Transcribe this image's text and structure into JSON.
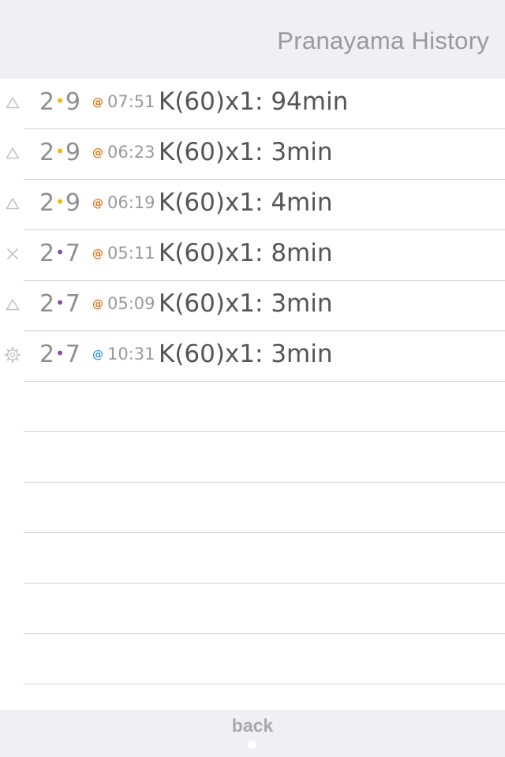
{
  "header": {
    "title": "Pranayama History"
  },
  "colors": {
    "dot_yellow": "#f4b400",
    "dot_purple": "#7a55a0",
    "at_orange": "#e0781e",
    "at_blue": "#3a9ad9",
    "icon_gray": "#c4c4c4"
  },
  "history": [
    {
      "status_icon": "triangle-icon",
      "day_left": "2",
      "day_right": "9",
      "dot_color": "yellow",
      "at_symbol": "@",
      "at_color": "orange",
      "time": "07:51",
      "entry": "K(60)x1: 94min"
    },
    {
      "status_icon": "triangle-icon",
      "day_left": "2",
      "day_right": "9",
      "dot_color": "yellow",
      "at_symbol": "@",
      "at_color": "orange",
      "time": "06:23",
      "entry": "K(60)x1: 3min"
    },
    {
      "status_icon": "triangle-icon",
      "day_left": "2",
      "day_right": "9",
      "dot_color": "yellow",
      "at_symbol": "@",
      "at_color": "orange",
      "time": "06:19",
      "entry": "K(60)x1: 4min"
    },
    {
      "status_icon": "x-icon",
      "day_left": "2",
      "day_right": "7",
      "dot_color": "purple",
      "at_symbol": "@",
      "at_color": "orange",
      "time": "05:11",
      "entry": "K(60)x1: 8min"
    },
    {
      "status_icon": "triangle-icon",
      "day_left": "2",
      "day_right": "7",
      "dot_color": "purple",
      "at_symbol": "@",
      "at_color": "orange",
      "time": "05:09",
      "entry": "K(60)x1: 3min"
    },
    {
      "status_icon": "gear-icon",
      "day_left": "2",
      "day_right": "7",
      "dot_color": "purple",
      "at_symbol": "@",
      "at_color": "blue",
      "time": "10:31",
      "entry": "K(60)x1: 3min"
    }
  ],
  "footer": {
    "back_label": "back"
  }
}
